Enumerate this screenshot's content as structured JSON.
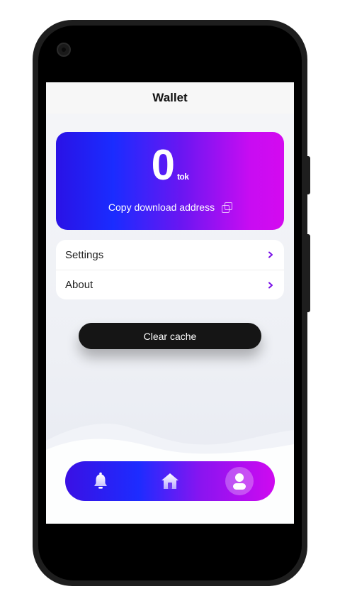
{
  "header": {
    "title": "Wallet"
  },
  "wallet": {
    "balance": "0",
    "unit": "tok",
    "copy_label": "Copy download address"
  },
  "menu": {
    "items": [
      {
        "label": "Settings"
      },
      {
        "label": "About"
      }
    ]
  },
  "actions": {
    "clear_cache_label": "Clear cache"
  },
  "tabbar": {
    "tabs": [
      {
        "icon": "bell-icon",
        "active": false
      },
      {
        "icon": "home-icon",
        "active": false
      },
      {
        "icon": "profile-icon",
        "active": true
      }
    ]
  },
  "colors": {
    "accent_purple": "#7a12e8",
    "gradient_start": "#1a2cff",
    "gradient_end": "#d40af0",
    "button_dark": "#151515"
  }
}
